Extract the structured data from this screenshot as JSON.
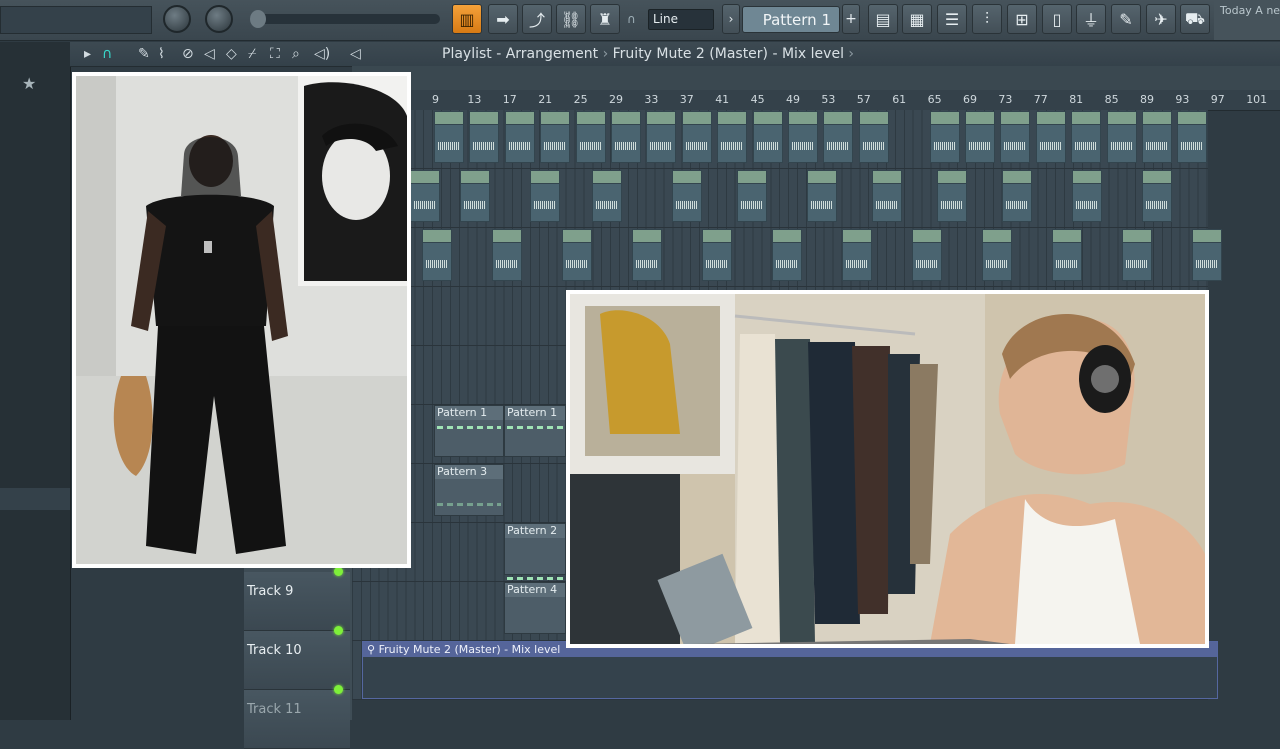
{
  "toolbar": {
    "snap_mode": "Line",
    "pattern_selector": "Pattern 1",
    "add_pattern": "+",
    "hint_text": "Today  A new version of FL"
  },
  "playlist": {
    "breadcrumb": "Playlist - Arrangement",
    "separator1": "›",
    "target": "Fruity Mute 2 (Master) - Mix level",
    "separator2": "›"
  },
  "ruler": {
    "bars": [
      "9",
      "13",
      "17",
      "21",
      "25",
      "29",
      "33",
      "37",
      "41",
      "45",
      "49",
      "53",
      "57",
      "61",
      "65",
      "69",
      "73",
      "77",
      "81",
      "85",
      "89",
      "93",
      "97",
      "101"
    ]
  },
  "tracks": [
    {
      "name": "Track 9"
    },
    {
      "name": "Track 10"
    },
    {
      "name": "Track 11"
    }
  ],
  "pattern_clips": [
    {
      "label": "Pattern 1"
    },
    {
      "label": "Pattern 1"
    },
    {
      "label": "Pattern 3"
    },
    {
      "label": "Pattern 2"
    },
    {
      "label": "Pattern 4"
    }
  ],
  "automation_clip": {
    "label": "Fruity Mute 2 (Master) - Mix level"
  },
  "overlays": {
    "left_photo_icon": "person-photo",
    "right_photo_icon": "person-with-headphones-photo"
  }
}
